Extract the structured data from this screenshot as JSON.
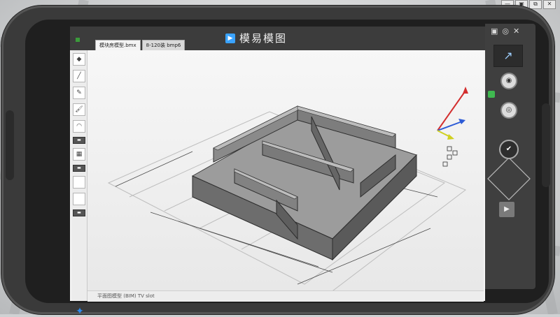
{
  "host_window": {
    "controls": [
      "—",
      "▣",
      "⧉",
      "✕"
    ]
  },
  "app": {
    "title": "模易模图",
    "tabs": [
      {
        "label": "模块房模型.bmx",
        "active": true
      },
      {
        "label": "8-120装 bmp6",
        "active": false
      }
    ],
    "status_text": "平面图模型  (BIM)  TV  slot"
  },
  "toolbar": {
    "items": [
      {
        "name": "toolbar-shape-icon",
        "glyph": "◆"
      },
      {
        "name": "toolbar-pen-icon",
        "glyph": "╱"
      },
      {
        "name": "toolbar-brush-icon",
        "glyph": "✎"
      },
      {
        "name": "toolbar-paint-icon",
        "glyph": "🖌"
      },
      {
        "name": "toolbar-arc-icon",
        "glyph": "◠"
      },
      {
        "name": "toolbar-layer-dark-1",
        "glyph": "▬"
      },
      {
        "name": "toolbar-color-icon",
        "glyph": "▦"
      },
      {
        "name": "toolbar-layer-dark-2",
        "glyph": "▬"
      },
      {
        "name": "toolbar-blank-1",
        "glyph": ""
      },
      {
        "name": "toolbar-blank-2",
        "glyph": ""
      },
      {
        "name": "toolbar-layer-dark-3",
        "glyph": "▬"
      }
    ],
    "nav_glyph": "✦"
  },
  "right_panel": {
    "top_controls": [
      "▣",
      "◎",
      "✕"
    ],
    "mode_glyph": "↗",
    "camera_glyph": "◉",
    "target_glyph": "◎",
    "confirm_glyph": "✔",
    "forward_glyph": "▶"
  },
  "colors": {
    "accent": "#3aa3ff",
    "titlebar": "#3c3c3c",
    "axis_x": "#2d5bd6",
    "axis_y": "#d0d020",
    "axis_z": "#d32f2f"
  }
}
